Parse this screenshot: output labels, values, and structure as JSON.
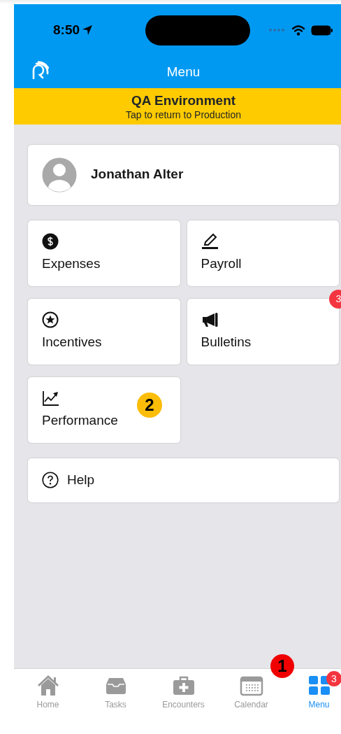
{
  "status_bar": {
    "time": "8:50"
  },
  "header": {
    "title": "Menu"
  },
  "environment_banner": {
    "title": "QA Environment",
    "subtitle": "Tap to return to Production"
  },
  "profile": {
    "name": "Jonathan Alter"
  },
  "tile_rows": [
    [
      {
        "label": "Expenses"
      },
      {
        "label": "Payroll"
      }
    ],
    [
      {
        "label": "Incentives"
      },
      {
        "label": "Bulletins",
        "badge": "3"
      }
    ],
    [
      {
        "label": "Performance",
        "callout": "2"
      }
    ]
  ],
  "help": {
    "label": "Help"
  },
  "tab_bar": {
    "callout": "1",
    "tabs": [
      {
        "label": "Home",
        "selected": false
      },
      {
        "label": "Tasks",
        "selected": false
      },
      {
        "label": "Encounters",
        "selected": false
      },
      {
        "label": "Calendar",
        "selected": false
      },
      {
        "label": "Menu",
        "selected": true,
        "badge": "3"
      }
    ]
  }
}
